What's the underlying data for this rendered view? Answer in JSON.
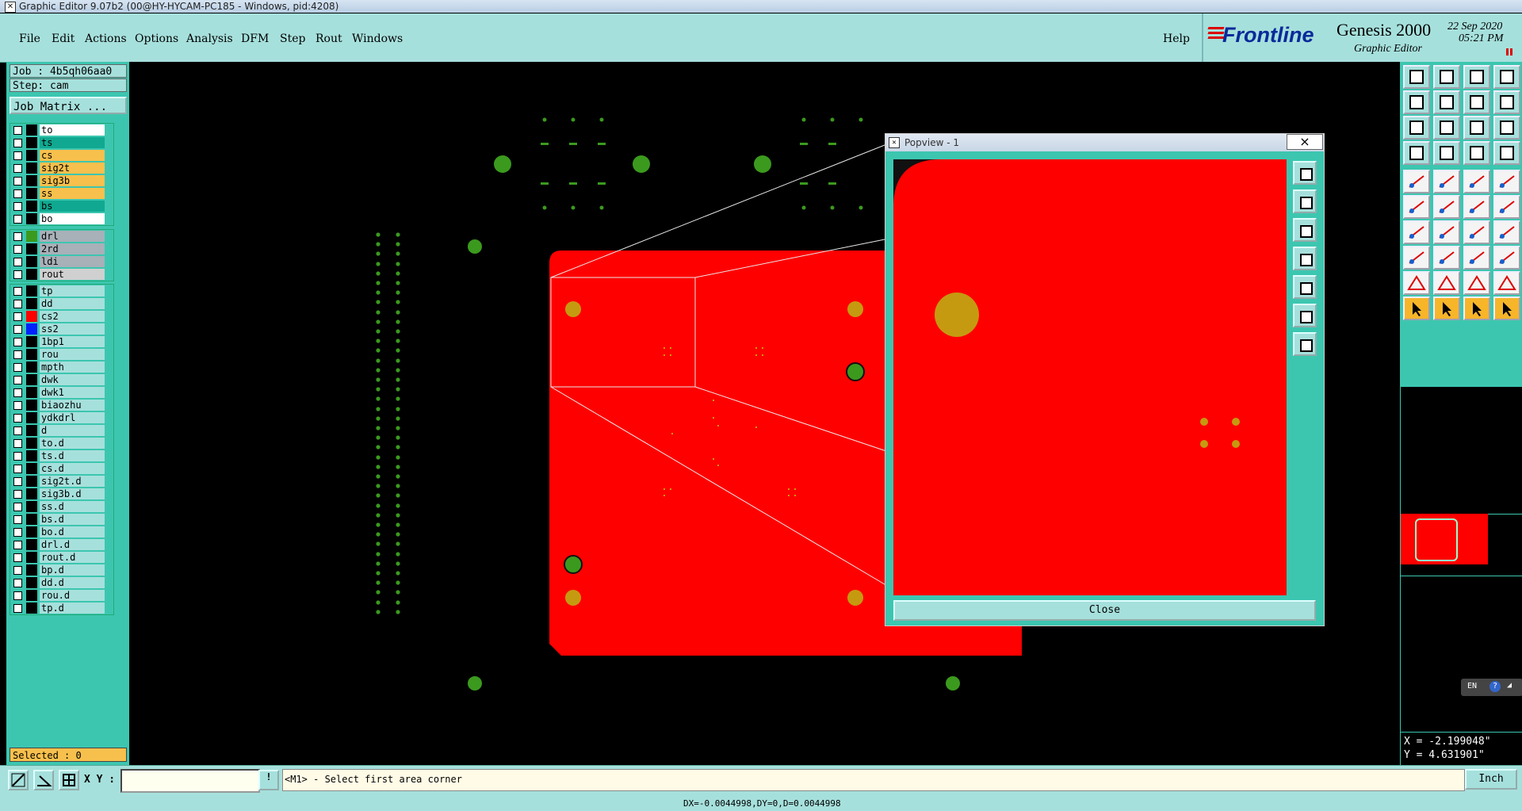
{
  "window": {
    "title": "Graphic Editor 9.07b2 (00@HY-HYCAM-PC185 - Windows, pid:4208)"
  },
  "menu": [
    "File",
    "Edit",
    "Actions",
    "Options",
    "Analysis",
    "DFM",
    "Step",
    "Rout",
    "Windows"
  ],
  "help_label": "Help",
  "brand": {
    "logo": "Frontline",
    "product": "Genesis 2000",
    "subtitle": "Graphic Editor",
    "date": "22 Sep 2020",
    "time": "05:21 PM"
  },
  "job": {
    "job_label": "Job : 4b5qh06aa0",
    "step_label": "Step: cam",
    "matrix_button": "Job Matrix ..."
  },
  "layers": {
    "board": [
      {
        "name": "to",
        "color": "#ffffff"
      },
      {
        "name": "ts",
        "color": "#10a890"
      },
      {
        "name": "cs",
        "color": "#f7c04d"
      },
      {
        "name": "sig2t",
        "color": "#f7c04d"
      },
      {
        "name": "sig3b",
        "color": "#f7c04d"
      },
      {
        "name": "ss",
        "color": "#f7c04d"
      },
      {
        "name": "bs",
        "color": "#10a890"
      },
      {
        "name": "bo",
        "color": "#ffffff"
      }
    ],
    "drill": [
      {
        "name": "drl",
        "color": "#a8b0b8",
        "swatch": "#3b9a1e"
      },
      {
        "name": "2rd",
        "color": "#a8b0b8"
      },
      {
        "name": "ldi",
        "color": "#a8b0b8"
      },
      {
        "name": "rout",
        "color": "#d0d0d0"
      }
    ],
    "misc": [
      {
        "name": "tp",
        "color": "#a6e0dc"
      },
      {
        "name": "dd",
        "color": "#a6e0dc"
      },
      {
        "name": "cs2",
        "color": "#a6e0dc",
        "swatch": "#ff0000"
      },
      {
        "name": "ss2",
        "color": "#a6e0dc",
        "swatch": "#0022ff"
      },
      {
        "name": "1bp1",
        "color": "#a6e0dc"
      },
      {
        "name": "rou",
        "color": "#a6e0dc"
      },
      {
        "name": "mpth",
        "color": "#a6e0dc"
      },
      {
        "name": "dwk",
        "color": "#a6e0dc"
      },
      {
        "name": "dwk1",
        "color": "#a6e0dc"
      },
      {
        "name": "biaozhu",
        "color": "#a6e0dc"
      },
      {
        "name": "ydkdrl",
        "color": "#a6e0dc"
      },
      {
        "name": "d",
        "color": "#a6e0dc"
      },
      {
        "name": "to.d",
        "color": "#a6e0dc"
      },
      {
        "name": "ts.d",
        "color": "#a6e0dc"
      },
      {
        "name": "cs.d",
        "color": "#a6e0dc"
      },
      {
        "name": "sig2t.d",
        "color": "#a6e0dc"
      },
      {
        "name": "sig3b.d",
        "color": "#a6e0dc"
      },
      {
        "name": "ss.d",
        "color": "#a6e0dc"
      },
      {
        "name": "bs.d",
        "color": "#a6e0dc"
      },
      {
        "name": "bo.d",
        "color": "#a6e0dc"
      },
      {
        "name": "drl.d",
        "color": "#a6e0dc"
      },
      {
        "name": "rout.d",
        "color": "#a6e0dc"
      },
      {
        "name": "bp.d",
        "color": "#a6e0dc"
      },
      {
        "name": "dd.d",
        "color": "#a6e0dc"
      },
      {
        "name": "rou.d",
        "color": "#a6e0dc"
      },
      {
        "name": "tp.d",
        "color": "#a6e0dc"
      }
    ]
  },
  "selected": "Selected : 0",
  "xy_label": "X Y :",
  "xy_value": "",
  "prompt": "<M1> - Select first area corner",
  "units": "Inch",
  "coords": {
    "x": "X = -2.199048\"",
    "y": "Y = 4.631901\""
  },
  "lang": "EN",
  "status_line": "DX=-0.0044998,DY=0,D=0.0044998",
  "popview": {
    "title": "Popview - 1",
    "close_label": "Close",
    "close_x": "×"
  },
  "colors": {
    "board": "#ff0000",
    "pad_green": "#3b9a1e",
    "pad_orange": "#c69a10",
    "panel_teal": "#3cc6b0",
    "menu_bg": "#a6e0dc"
  }
}
